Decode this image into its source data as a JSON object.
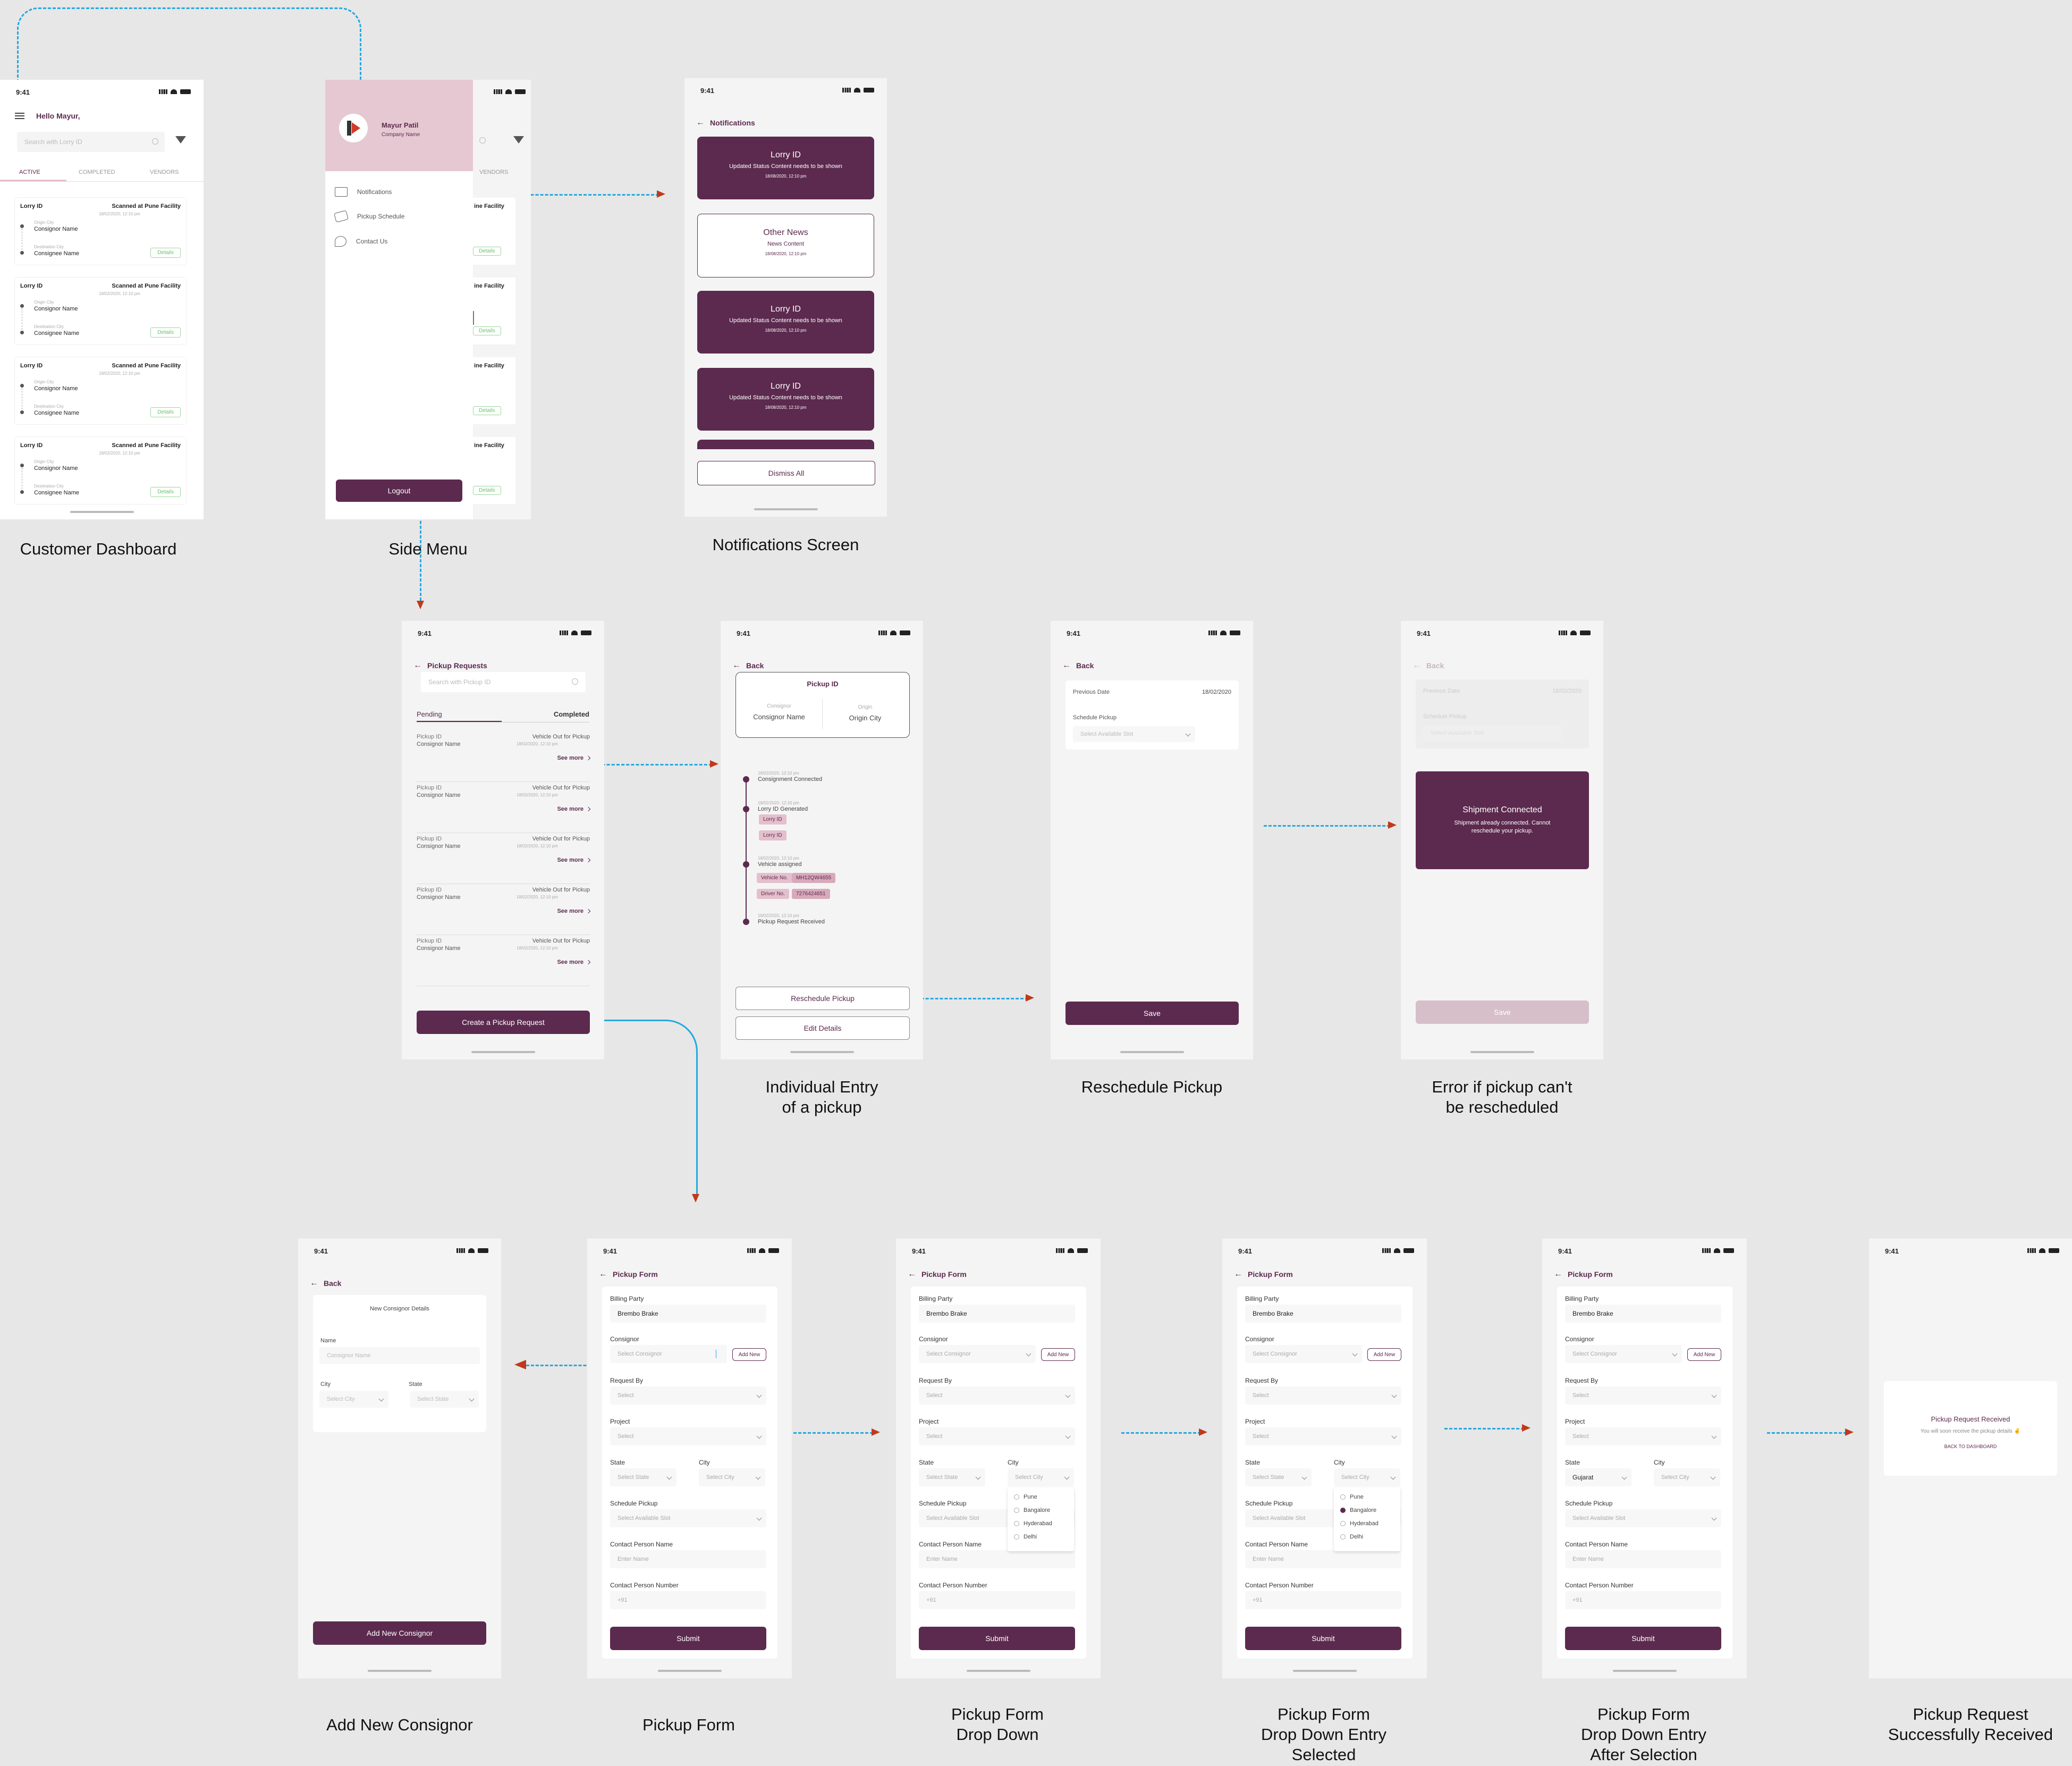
{
  "common": {
    "time": "9:41",
    "back": "Back",
    "see_more": "See more",
    "details": "Details",
    "select": "Select",
    "select_state": "Select State",
    "select_city": "Select City",
    "select_slot": "Select Available Slot",
    "select_consignor": "Select Consignor",
    "enter_name": "Enter Name",
    "phone_prefix": "+91",
    "add_new": "Add New",
    "submit": "Submit",
    "save": "Save"
  },
  "dashboard": {
    "greeting": "Hello Mayur,",
    "search_placeholder": "Search with Lorry ID",
    "tabs": [
      "ACTIVE",
      "COMPLETED",
      "VENDORS"
    ],
    "cards": [
      {
        "title": "Lorry ID",
        "status": "Scanned at Pune Facility",
        "date": "18/02/2020, 12:10 pm",
        "origin_label": "Origin City",
        "origin": "Consignor Name",
        "dest_label": "Destination City",
        "dest": "Consignee Name"
      },
      {
        "title": "Lorry ID",
        "status": "Scanned at Pune Facility",
        "date": "18/02/2020, 12:10 pm",
        "origin_label": "Origin City",
        "origin": "Consignor Name",
        "dest_label": "Destination City",
        "dest": "Consignee Name"
      },
      {
        "title": "Lorry ID",
        "status": "Scanned at Pune Facility",
        "date": "18/02/2020, 12:10 pm",
        "origin_label": "Origin City",
        "origin": "Consignor Name",
        "dest_label": "Destination City",
        "dest": "Consignee Name"
      },
      {
        "title": "Lorry ID",
        "status": "Scanned at Pune Facility",
        "date": "18/02/2020, 12:10 pm",
        "origin_label": "Origin City",
        "origin": "Consignor Name",
        "dest_label": "Destination City",
        "dest": "Consignee Name"
      }
    ]
  },
  "side_menu": {
    "user_name": "Mayur Patil",
    "company": "Company Name",
    "items": [
      "Notifications",
      "Pickup Schedule",
      "Contact Us"
    ],
    "logout": "Logout",
    "bg_tab": "VENDORS",
    "bg_card_status": "ine Facility"
  },
  "notifications": {
    "title": "Notifications",
    "items": [
      {
        "title": "Lorry ID",
        "body": "Updated Status Content needs to be shown",
        "date": "18/08/2020, 12:10 pm",
        "style": "dark"
      },
      {
        "title": "Other News",
        "body": "News Content",
        "date": "18/08/2020, 12:10 pm",
        "style": "light"
      },
      {
        "title": "Lorry ID",
        "body": "Updated Status Content needs to be shown",
        "date": "18/08/2020, 12:10 pm",
        "style": "dark"
      },
      {
        "title": "Lorry ID",
        "body": "Updated Status Content needs to be shown",
        "date": "18/08/2020, 12:10 pm",
        "style": "dark"
      }
    ],
    "dismiss": "Dismiss All"
  },
  "pickup_requests": {
    "title": "Pickup Requests",
    "search_placeholder": "Search with Pickup ID",
    "tabs": [
      "Pending",
      "Completed"
    ],
    "row": {
      "id": "Pickup ID",
      "name": "Consignor Name",
      "status": "Vehicle Out for Pickup",
      "date": "18/02/2020, 12:10 pm"
    },
    "create": "Create a Pickup Request"
  },
  "individual": {
    "card_title": "Pickup ID",
    "consignor_label": "Consignor",
    "consignor": "Consignor Name",
    "origin_label": "Origin",
    "origin": "Origin City",
    "timeline": [
      {
        "date": "18/02/2020, 12:10 pm",
        "event": "Consignment Connected"
      },
      {
        "date": "18/02/2020, 12:10 pm",
        "event": "Lorry ID Generated"
      },
      {
        "date": "18/02/2020, 12:10 pm",
        "event": "Vehicle assigned"
      },
      {
        "date": "18/02/2020, 12:10 pm",
        "event": "Pickup Request Received"
      }
    ],
    "chips": [
      "Lorry ID",
      "Lorry ID"
    ],
    "vehicle_label": "Vehicle No.",
    "vehicle": "MH12QW4655",
    "driver_label": "Driver No.",
    "driver": "7276424651",
    "reschedule": "Reschedule Pickup",
    "edit": "Edit Details"
  },
  "reschedule": {
    "prev_label": "Previous Date",
    "prev_date": "18/02/2020",
    "schedule_label": "Schedule Pickup"
  },
  "error": {
    "title": "Shipment Connected",
    "body": "Shipment already connected. Cannot reschedule your pickup."
  },
  "consignor_form": {
    "title": "New Consignor Details",
    "name_label": "Name",
    "name_placeholder": "Consignor Name",
    "city_label": "City",
    "state_label": "State",
    "add_btn": "Add New Consignor"
  },
  "pickup_form": {
    "title": "Pickup Form",
    "billing_label": "Billing Party",
    "billing": "Brembo Brake",
    "consignor_label": "Consignor",
    "request_by": "Request By",
    "project": "Project",
    "state": "State",
    "city": "City",
    "schedule": "Schedule Pickup",
    "contact_name": "Contact Person Name",
    "contact_number": "Contact Person Number",
    "cities": [
      "Pune",
      "Bangalore",
      "Hyderabad",
      "Delhi"
    ],
    "selected_state": "Gujarat",
    "consignor_typing": "Select Consignor"
  },
  "success": {
    "title": "Pickup Request Received",
    "body": "You will soon receive the pickup details ✌",
    "link": "BACK TO DASHBOARD"
  },
  "captions": {
    "dashboard": "Customer Dashboard",
    "side_menu": "Side Menu",
    "notifications": "Notifications Screen",
    "individual": "Individual Entry\nof a pickup",
    "reschedule": "Reschedule Pickup",
    "error": "Error if pickup can't\nbe rescheduled",
    "add_consignor": "Add New Consignor",
    "pickup_form": "Pickup Form",
    "dropdown": "Pickup Form\nDrop Down",
    "dropdown_selected": "Pickup Form\nDrop Down Entry\nSelected",
    "after_selection": "Pickup Form\nDrop Down Entry\nAfter Selection",
    "success": "Pickup Request\nSuccessfully Received"
  },
  "colors": {
    "brand": "#5c2a4e",
    "accent": "#e4bfcc",
    "connector": "#26a8e0",
    "arrow": "#c0391b"
  }
}
